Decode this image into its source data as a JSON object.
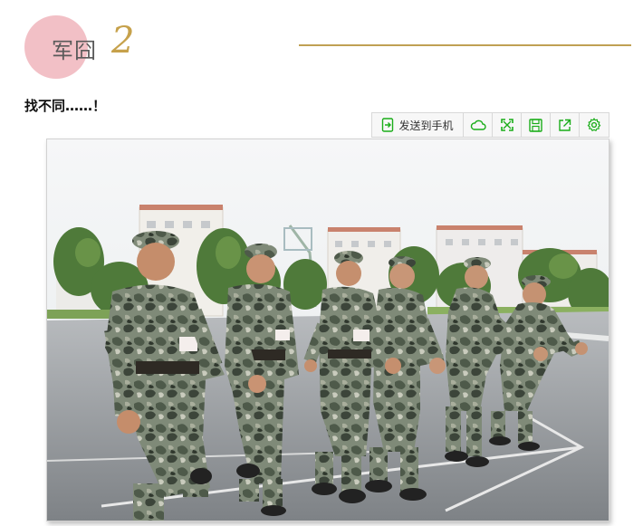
{
  "section": {
    "title": "军囧",
    "number": "2"
  },
  "caption": "找不同……！",
  "toolbar": {
    "send_label": "发送到手机",
    "icons": [
      "send-to-phone-icon",
      "cloud-icon",
      "fullscreen-icon",
      "save-icon",
      "share-icon",
      "settings-icon"
    ],
    "accent_color": "#1aad19"
  },
  "photo": {
    "subject": "soldiers-in-camouflage-photo"
  },
  "colors": {
    "pink_circle": "#f2c0c6",
    "gold": "#c0a053",
    "number_gold": "#c6a14b"
  }
}
